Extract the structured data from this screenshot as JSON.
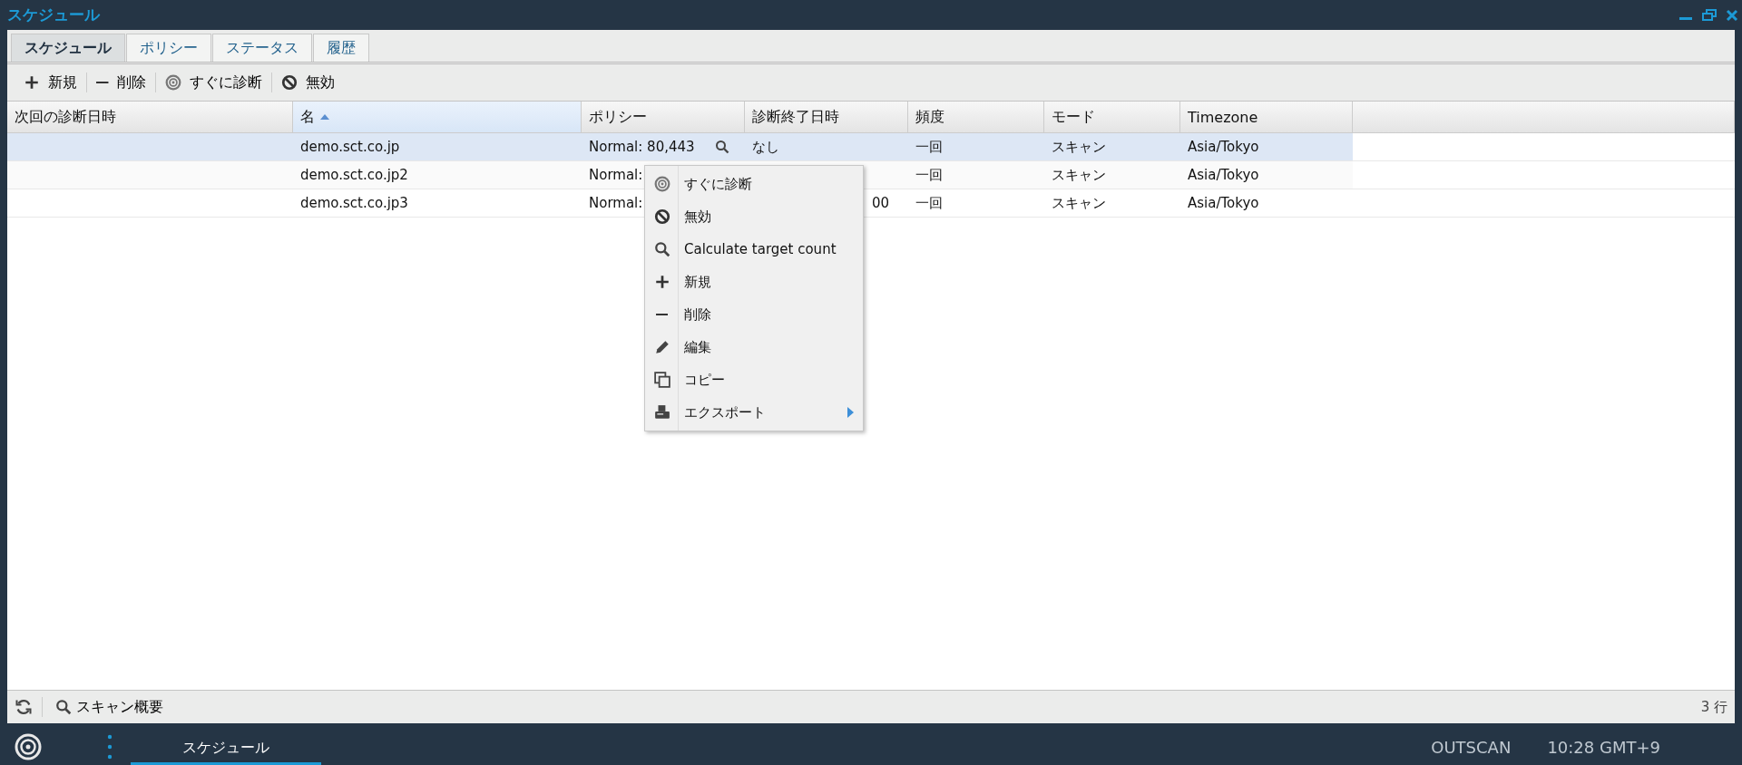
{
  "window": {
    "title": "スケジュール"
  },
  "tabs": [
    {
      "label": "スケジュール",
      "selected": true
    },
    {
      "label": "ポリシー",
      "selected": false
    },
    {
      "label": "ステータス",
      "selected": false
    },
    {
      "label": "履歴",
      "selected": false
    }
  ],
  "toolbar": [
    {
      "kind": "plus",
      "label": "新規"
    },
    {
      "kind": "minus",
      "label": "削除"
    },
    {
      "kind": "target",
      "label": "すぐに診断"
    },
    {
      "kind": "block",
      "label": "無効"
    }
  ],
  "table": {
    "columns": [
      {
        "label": "次回の診断日時",
        "sorted": false
      },
      {
        "label": "名",
        "sorted": true
      },
      {
        "label": "ポリシー",
        "sorted": false
      },
      {
        "label": "診断終了日時",
        "sorted": false
      },
      {
        "label": "頻度",
        "sorted": false
      },
      {
        "label": "モード",
        "sorted": false
      },
      {
        "label": "Timezone",
        "sorted": false
      }
    ],
    "rows": [
      {
        "selected": true,
        "search": true,
        "cells": [
          "",
          "demo.sct.co.jp",
          "Normal: 80,443",
          "なし",
          "一回",
          "スキャン",
          "Asia/Tokyo"
        ]
      },
      {
        "selected": false,
        "cells": [
          "",
          "demo.sct.co.jp2",
          "Normal:",
          "",
          "一回",
          "スキャン",
          "Asia/Tokyo"
        ]
      },
      {
        "selected": false,
        "cells": [
          "",
          "demo.sct.co.jp3",
          "Normal:",
          "00",
          "一回",
          "スキャン",
          "Asia/Tokyo"
        ]
      }
    ]
  },
  "context_menu": [
    {
      "kind": "target",
      "label": "すぐに診断",
      "submenu": false
    },
    {
      "kind": "block",
      "label": "無効",
      "submenu": false
    },
    {
      "kind": "search",
      "label": "Calculate target count",
      "submenu": false
    },
    {
      "kind": "plus",
      "label": "新規",
      "submenu": false
    },
    {
      "kind": "minus",
      "label": "削除",
      "submenu": false
    },
    {
      "kind": "pencil",
      "label": "編集",
      "submenu": false
    },
    {
      "kind": "copy",
      "label": "コピー",
      "submenu": false
    },
    {
      "kind": "printer",
      "label": "エクスポート",
      "submenu": true
    }
  ],
  "status_bar": {
    "link": "スキャン概要",
    "count": "3 行"
  },
  "taskbar": {
    "task": "スケジュール",
    "product": "OUTSCAN",
    "clock": "10:28 GMT+9"
  }
}
